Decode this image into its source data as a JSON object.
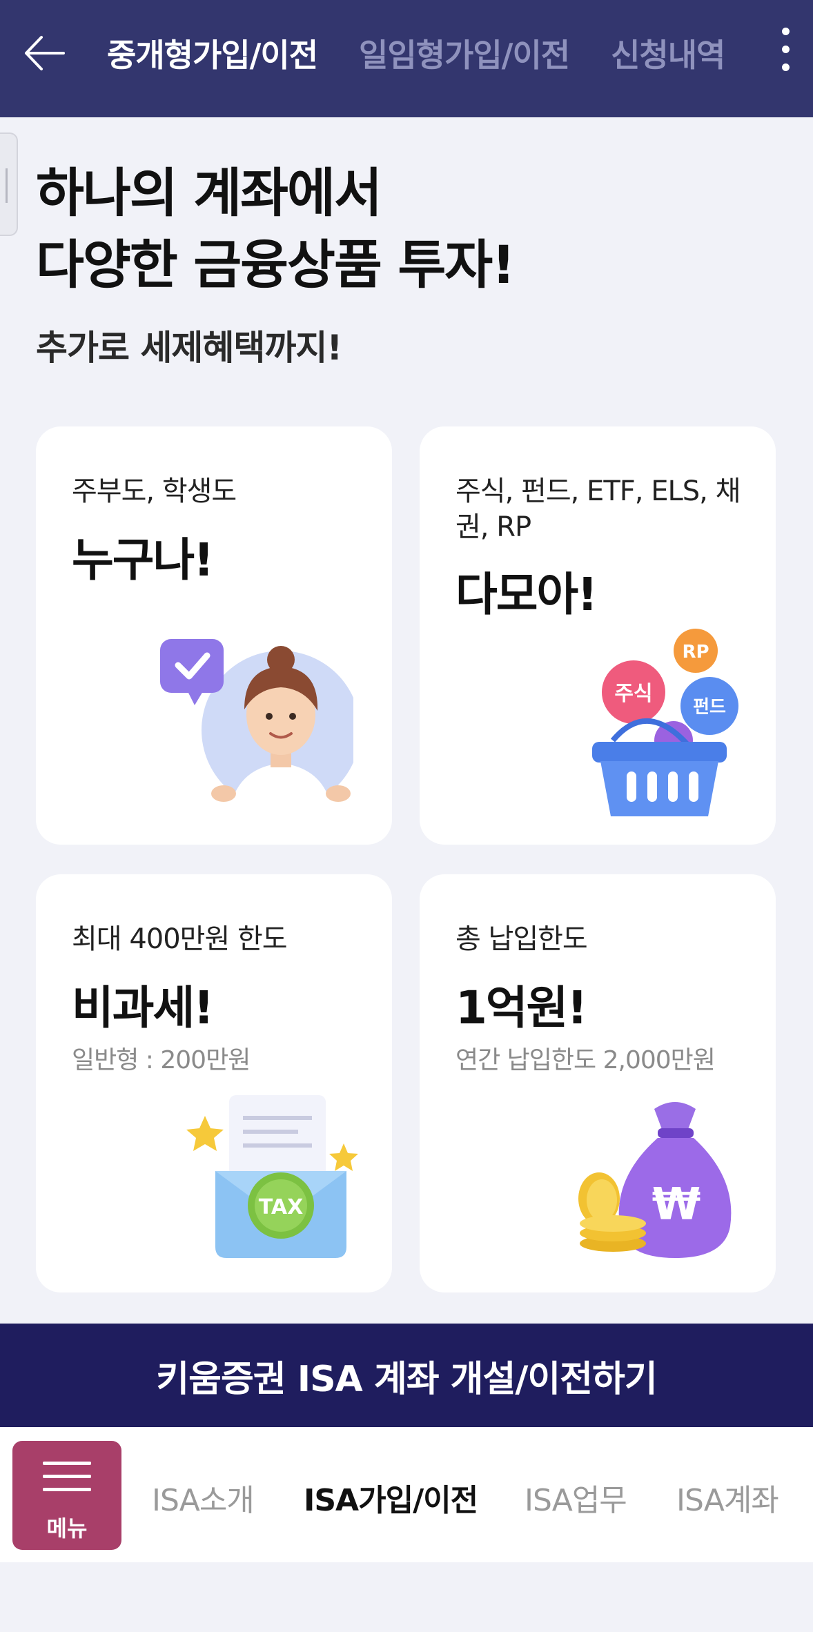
{
  "header": {
    "tabs": [
      {
        "label": "중개형가입/이전"
      },
      {
        "label": "일임형가입/이전"
      },
      {
        "label": "신청내역"
      }
    ],
    "back_icon": "arrow-left-icon",
    "more_icon": "kebab-menu-icon"
  },
  "hero": {
    "title_line1": "하나의 계좌에서",
    "title_line2": "다양한 금융상품 투자!",
    "subtitle": "추가로 세제혜택까지!"
  },
  "cards": [
    {
      "sub": "주부도, 학생도",
      "main": "누구나!",
      "note": "",
      "icon": "person-check-icon"
    },
    {
      "sub": "주식, 펀드, ETF, ELS, 채권, RP",
      "main": "다모아!",
      "note": "",
      "icon": "basket-icon",
      "balls": {
        "rp": "RP",
        "stock": "주식",
        "fund": "펀드"
      }
    },
    {
      "sub": "최대 400만원 한도",
      "main": "비과세!",
      "note": "일반형 : 200만원",
      "icon": "tax-envelope-icon",
      "badge": "TAX"
    },
    {
      "sub": "총 납입한도",
      "main": "1억원!",
      "note": "연간 납입한도 2,000만원",
      "icon": "money-bag-icon",
      "badge": "₩"
    }
  ],
  "cta": {
    "label": "키움증권 ISA 계좌 개설/이전하기"
  },
  "bottom_nav": {
    "menu_label": "메뉴",
    "items": [
      {
        "label": "ISA소개"
      },
      {
        "label": "ISA가입/이전"
      },
      {
        "label": "ISA업무"
      },
      {
        "label": "ISA계좌"
      }
    ]
  },
  "colors": {
    "header_bg": "#33366e",
    "cta_bg": "#1f1d5e",
    "menu_bg": "#a83f69",
    "page_bg": "#f1f2f8"
  }
}
